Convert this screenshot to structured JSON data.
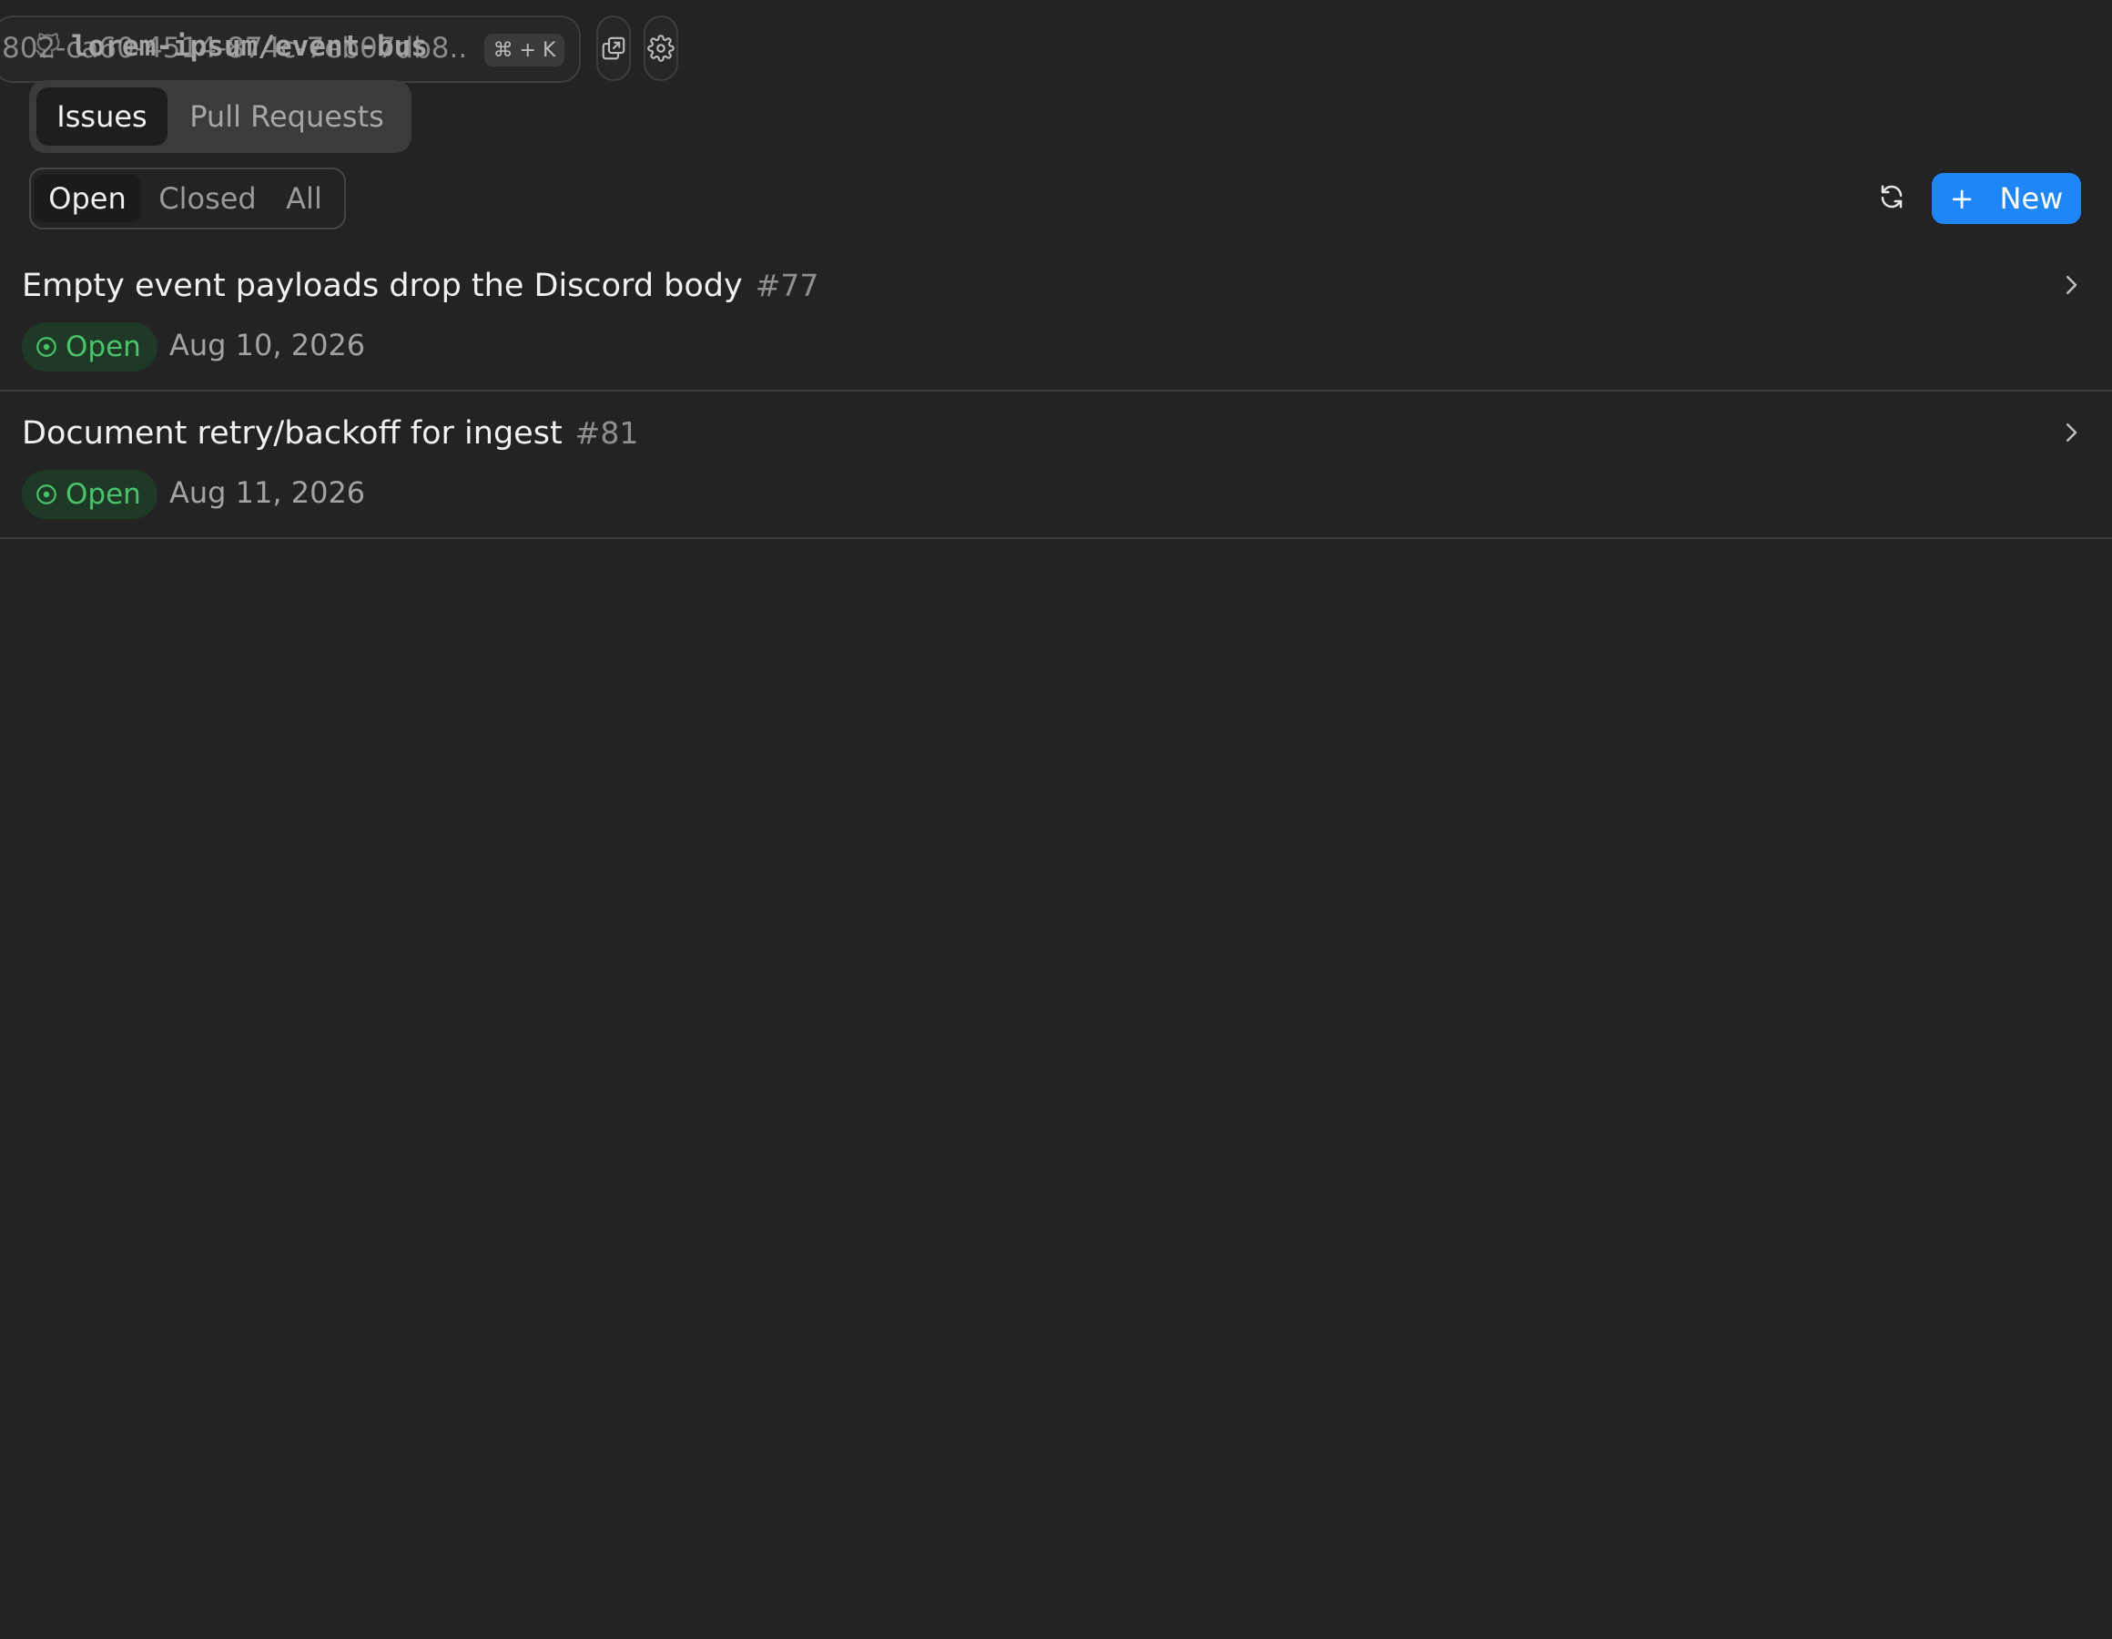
{
  "topbar": {
    "repo_underlay_text": "802-ca60-4514-874c-7eb07db8..",
    "repo_name": "lorem-ipsum/event-bus",
    "shortcut": "⌘ + K",
    "icons": [
      "github-icon",
      "external-window-icon",
      "gear-icon"
    ]
  },
  "tabs": [
    {
      "label": "Issues",
      "active": true
    },
    {
      "label": "Pull Requests",
      "active": false
    }
  ],
  "filters": [
    {
      "label": "Open",
      "active": true
    },
    {
      "label": "Closed",
      "active": false
    },
    {
      "label": "All",
      "active": false
    }
  ],
  "actions": {
    "refresh_icon": "refresh-icon",
    "new_label": "New",
    "new_icon": "+"
  },
  "issues": [
    {
      "title": "Empty event payloads drop the Discord body",
      "number": "#77",
      "status": "Open",
      "date": "Aug 10, 2026"
    },
    {
      "title": "Document retry/backoff for ingest",
      "number": "#81",
      "status": "Open",
      "date": "Aug 11, 2026"
    }
  ],
  "colors": {
    "background": "#232323",
    "accent": "#1f86f7",
    "open_green": "#4ac26b",
    "open_badge_bg": "#1e3a26"
  }
}
